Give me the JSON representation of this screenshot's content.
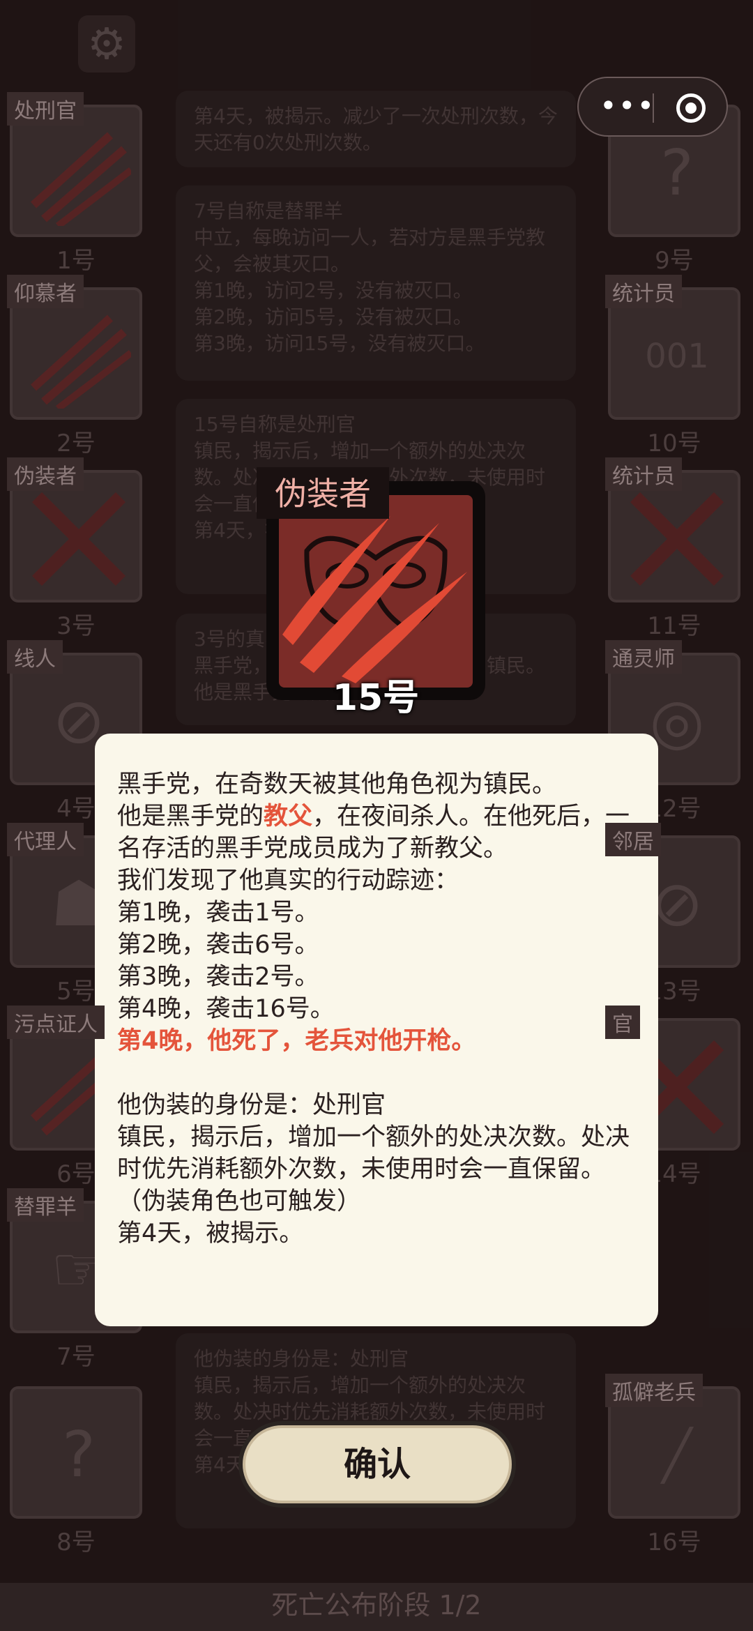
{
  "board": {
    "seats_left": [
      {
        "role": "处刑官",
        "num": "1号"
      },
      {
        "role": "仰慕者",
        "num": "2号"
      },
      {
        "role": "伪装者",
        "num": "3号"
      },
      {
        "role": "线人",
        "num": "4号"
      },
      {
        "role": "代理人",
        "num": "5号"
      },
      {
        "role": "污点证人",
        "num": "6号"
      },
      {
        "role": "替罪羊",
        "num": "7号"
      },
      {
        "role": "",
        "num": "8号"
      }
    ],
    "seats_right": [
      {
        "role": "",
        "num": "9号"
      },
      {
        "role": "统计员",
        "num": "10号"
      },
      {
        "role": "统计员",
        "num": "11号"
      },
      {
        "role": "通灵师",
        "num": "12号"
      },
      {
        "role": "邻居",
        "num": "13号"
      },
      {
        "role": "官",
        "num": "14号"
      },
      {
        "role": "孤僻老兵",
        "num": "16号"
      }
    ],
    "logs": [
      "第4天，被揭示。减少了一次处刑次数，今天还有0次处刑次数。",
      "7号自称是替罪羊\n中立，每晚访问一人，若对方是黑手党教父，会被其灭口。\n第1晚，访问2号，没有被灭口。\n第2晚，访问5号，没有被灭口。\n第3晚，访问15号，没有被灭口。",
      "15号自称是处刑官\n镇民，揭示后，增加一个额外的处决次数。处决时优先消耗额外次数，未使用时会一直保留。（伪装角色也可触发）\n第4天，被揭示。",
      "3号的真实身份\n黑手党，在奇数天被其他角色视为镇民。\n他是黑手党的成员。",
      "他伪装的身份是：处刑官\n镇民，揭示后，增加一个额外的处决次数。处决时优先消耗额外次数，未使用时会一直保留。（伪装角色也可触发）\n第4天，被揭示。"
    ]
  },
  "capsule": {
    "more": "•••",
    "close_icon": "target-icon"
  },
  "reveal": {
    "role": "伪装者",
    "num": "15号"
  },
  "dialog": {
    "l1": "黑手党，在奇数天被其他角色视为镇民。",
    "l2a": "他是黑手党的",
    "l2b": "教父",
    "l2c": "，在夜间杀人。在他死后，一名存活的黑手党成员成为了新教父。",
    "l3": "我们发现了他真实的行动踪迹：",
    "l4": "第1晚，袭击1号。",
    "l5": "第2晚，袭击6号。",
    "l6": "第3晚，袭击2号。",
    "l7": "第4晚，袭击16号。",
    "l8": "第4晚，他死了，老兵对他开枪。",
    "l9": "他伪装的身份是：处刑官",
    "l10": "镇民，揭示后，增加一个额外的处决次数。处决时优先消耗额外次数，未使用时会一直保留。（伪装角色也可触发）",
    "l11": "第4天，被揭示。"
  },
  "confirm_label": "确认",
  "footer": "死亡公布阶段 1/2",
  "colors": {
    "accent": "#e4543b",
    "backdrop": "#251a1a",
    "dialog": "#faf7ea"
  }
}
